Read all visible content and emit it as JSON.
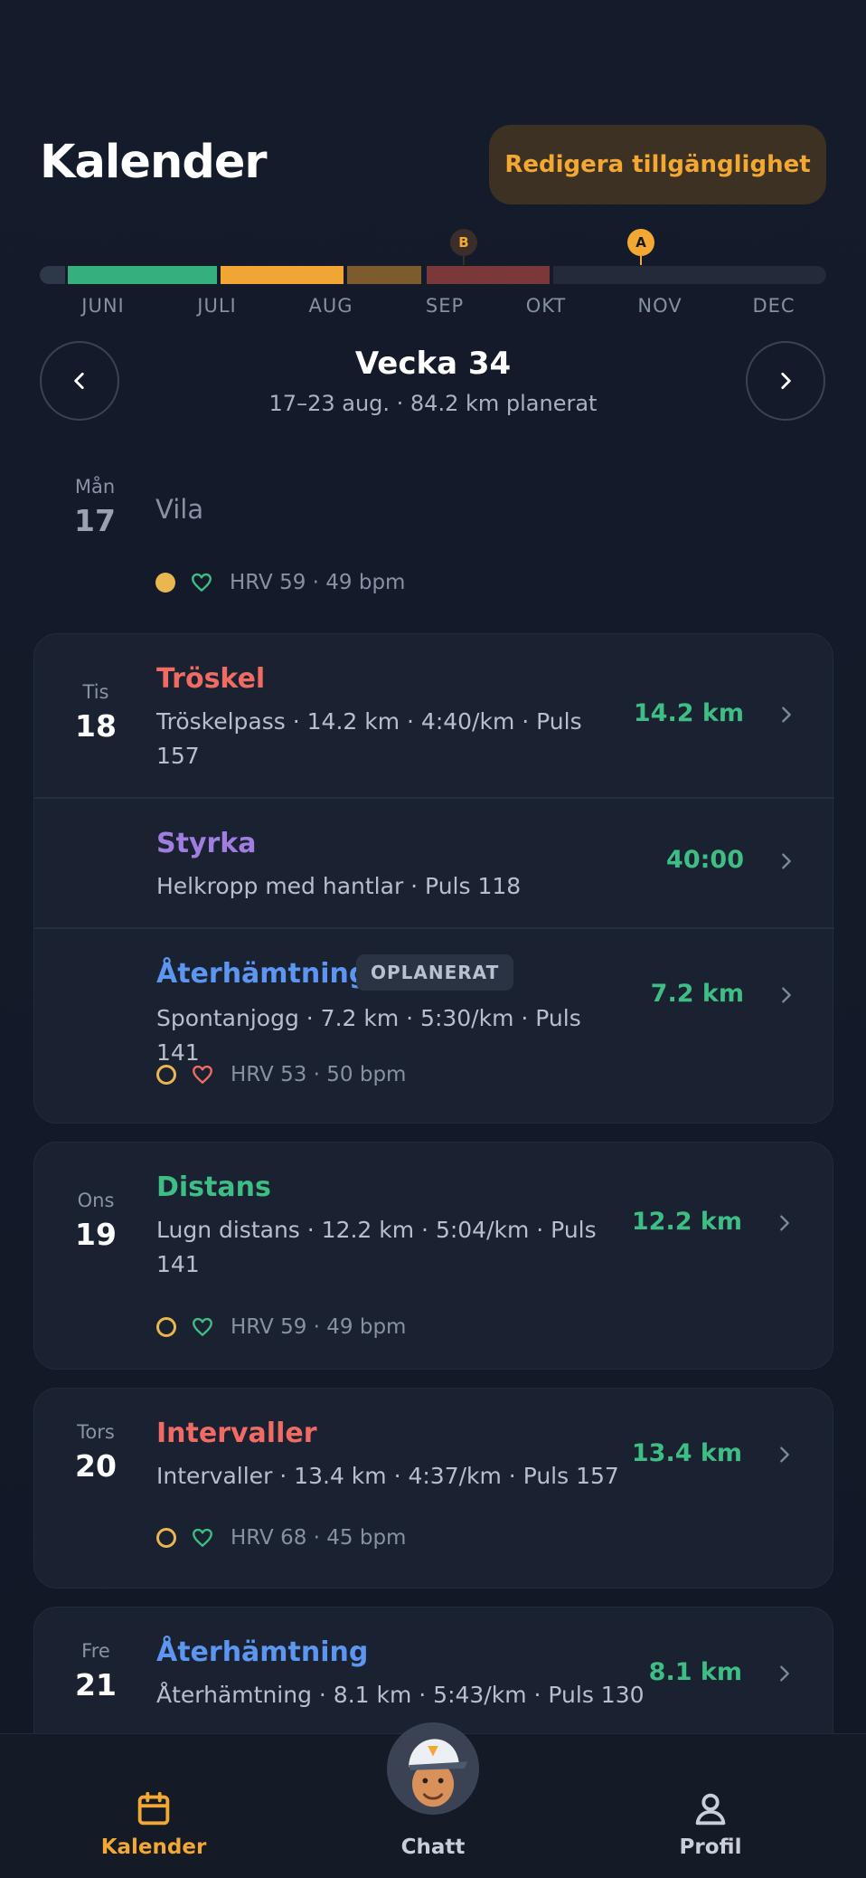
{
  "header": {
    "title": "Kalender",
    "edit_button": "Redigera tillgänglighet"
  },
  "timeline": {
    "months": [
      "JUNI",
      "JULI",
      "AUG",
      "SEP",
      "OKT",
      "NOV",
      "DEC"
    ],
    "markers": [
      {
        "label": "B",
        "color": "#3a2e2a"
      },
      {
        "label": "A",
        "color": "#f3a833"
      }
    ],
    "phase_colors": [
      "#2f3848",
      "#35b07d",
      "#f0a534",
      "#7c5c2e",
      "#7a3838",
      "#232b3b"
    ]
  },
  "week": {
    "title": "Vecka 34",
    "subtitle": "17–23 aug. · 84.2 km planerat",
    "prev_icon": "chevron-left-icon",
    "next_icon": "chevron-right-icon"
  },
  "days": {
    "mon": {
      "dow": "Mån",
      "num": "17",
      "title": "Vila",
      "hrv": "HRV 59 · 49 bpm"
    },
    "tue": {
      "dow": "Tis",
      "num": "18",
      "workouts": [
        {
          "title": "Tröskel",
          "desc": "Tröskelpass · 14.2 km · 4:40/km · Puls 157",
          "value": "14.2 km",
          "color": "#ef6b63"
        },
        {
          "title": "Styrka",
          "desc": "Helkropp med hantlar · Puls 118",
          "value": "40:00",
          "color": "#a07ee0"
        },
        {
          "title": "Återhämtning",
          "badge": "OPLANERAT",
          "desc": "Spontanjogg · 7.2 km · 5:30/km · Puls 141",
          "value": "7.2 km",
          "color": "#5c96f0"
        }
      ],
      "hrv": "HRV 53 · 50 bpm"
    },
    "wed": {
      "dow": "Ons",
      "num": "19",
      "workout": {
        "title": "Distans",
        "desc": "Lugn distans · 12.2 km · 5:04/km · Puls 141",
        "value": "12.2 km",
        "color": "#3ebd84"
      },
      "hrv": "HRV 59 · 49 bpm"
    },
    "thu": {
      "dow": "Tors",
      "num": "20",
      "workout": {
        "title": "Intervaller",
        "desc": "Intervaller · 13.4 km · 4:37/km · Puls 157",
        "value": "13.4 km",
        "color": "#ef6b63"
      },
      "hrv": "HRV 68 · 45 bpm"
    },
    "fri": {
      "dow": "Fre",
      "num": "21",
      "workout": {
        "title": "Återhämtning",
        "desc": "Återhämtning · 8.1 km · 5:43/km · Puls 130",
        "value": "8.1 km",
        "color": "#5c96f0"
      }
    }
  },
  "bottom_nav": {
    "tabs": [
      {
        "label": "Kalender",
        "icon": "calendar-icon",
        "active": true
      },
      {
        "label": "Chatt",
        "icon": "coach-avatar",
        "active": false
      },
      {
        "label": "Profil",
        "icon": "person-icon",
        "active": false
      }
    ],
    "active_color": "#f3a833",
    "inactive_color": "#c9cfda"
  }
}
